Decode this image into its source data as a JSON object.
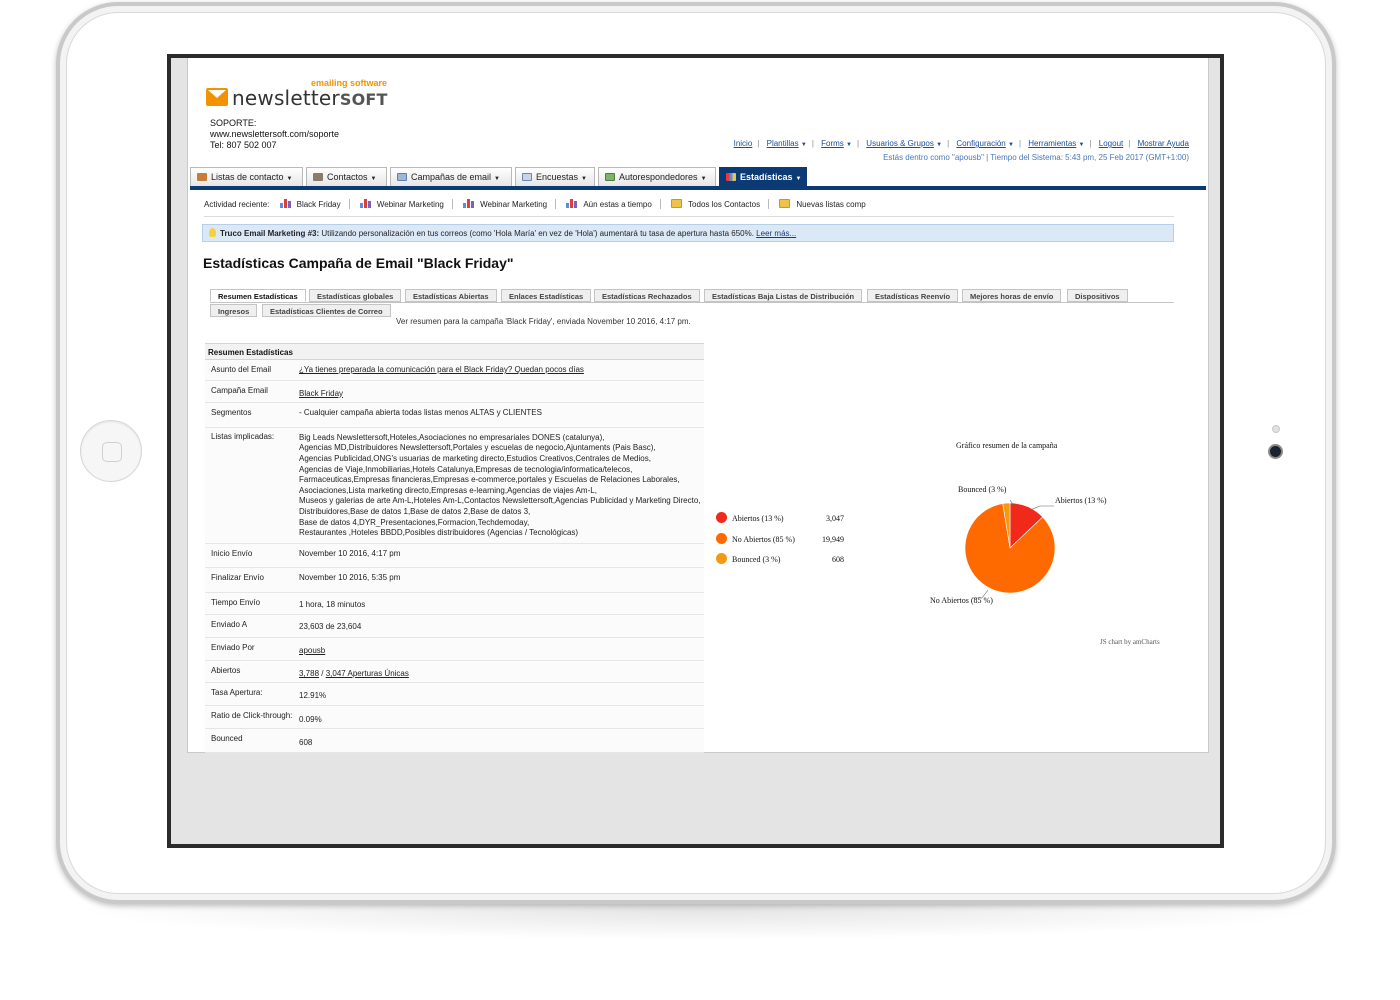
{
  "brand": {
    "name": "newsletter",
    "name_bold": "SOFT",
    "tagline": "emailing software"
  },
  "support": {
    "line1": "SOPORTE:",
    "line2": "www.newslettersoft.com/soporte",
    "line3": "Tel: 807 502 007"
  },
  "topnav": {
    "items": [
      "Inicio",
      "Plantillas",
      "Forms",
      "Usuarios & Grupos",
      "Configuración",
      "Herramientas",
      "Logout",
      "Mostrar Ayuda"
    ],
    "sysinfo": "Estás dentro como \"apousb\" | Tiempo del Sistema: 5:43 pm, 25 Feb 2017 (GMT+1:00)"
  },
  "tabs": [
    "Listas de contacto",
    "Contactos",
    "Campañas de email",
    "Encuestas",
    "Autorespondedores",
    "Estadísticas"
  ],
  "recent": {
    "label": "Actividad reciente:",
    "items": [
      "Black Friday",
      "Webinar Marketing",
      "Webinar Marketing",
      "Aún estas a tiempo",
      "Todos los Contactos",
      "Nuevas listas comp"
    ]
  },
  "tip": {
    "title": "Truco Email Marketing #3:",
    "text": " Utilizando personalización en tus correos (como 'Hola María' en vez de 'Hola') aumentará tu tasa de apertura hasta 650%.",
    "link": "Leer más..."
  },
  "page_title": "Estadísticas Campaña de Email \"Black Friday\"",
  "subtabs": [
    "Resumen Estadísticas",
    "Estadísticas globales",
    "Estadísticas Abiertas",
    "Enlaces Estadísticas",
    "Estadísticas Rechazados",
    "Estadísticas Baja Listas de Distribución",
    "Estadísticas Reenvío",
    "Mejores horas de envío",
    "Dispositivos",
    "Ingresos",
    "Estadísticas Clientes de Correo"
  ],
  "summary_line": "Ver resumen para la campaña 'Black Friday', enviada November 10 2016, 4:17 pm.",
  "stats": {
    "heading": "Resumen Estadísticas",
    "subject_label": "Asunto del Email",
    "subject": "¿Ya tienes preparada la comunicación para el Black Friday? Quedan pocos días",
    "campaign_label": "Campaña Email",
    "campaign": "Black Friday",
    "segments_label": "Segmentos",
    "segments": "- Cualquier campaña abierta todas listas menos ALTAS y CLIENTES",
    "lists_label": "Listas implicadas:",
    "lists": [
      "Big Leads Newslettersoft,Hoteles,Asociaciones no empresariales DONES (catalunya),",
      "Agencias MD,Distribuidores Newslettersoft,Portales y escuelas de negocio,Ajuntaments (Pais Basc),",
      "Agencias Publicidad,ONG's usuarias de marketing directo,Estudios Creativos,Centrales de Medios,",
      "Agencias de Viaje,Inmobiliarias,Hotels Catalunya,Empresas de tecnologia/informatica/telecos,",
      "Farmaceuticas,Empresas financieras,Empresas e-commerce,portales y Escuelas de Relaciones Laborales,",
      "Asociaciones,Lista marketing directo,Empresas e-learning,Agencias de viajes Am-L,",
      "Museos y galerias de arte Am-L,Hoteles Am-L,Contactos Newslettersoft,Agencias Publicidad y Marketing Directo,",
      "Distribuidores,Base de datos 1,Base de datos 2,Base de datos 3,",
      "Base de datos 4,DYR_Presentaciones,Formacion,Techdemoday,",
      "Restaurantes ,Hoteles BBDD,Posibles distribuidores (Agencias / Tecnológicas)"
    ],
    "start_label": "Inicio Envío",
    "start": "November 10 2016, 4:17 pm",
    "end_label": "Finalizar Envío",
    "end": "November 10 2016, 5:35 pm",
    "duration_label": "Tiempo Envío",
    "duration": "1 hora, 18 minutos",
    "sent_to_label": "Enviado A",
    "sent_to": "23,603 de 23,604",
    "sent_by_label": "Enviado Por",
    "sent_by": "apousb",
    "opens_label": "Abiertos",
    "opens_total": "3,788",
    "opens_sep": " / ",
    "opens_unique": "3,047 Aperturas Únicas",
    "open_rate_label": "Tasa Apertura:",
    "open_rate": "12.91%",
    "ctr_label": "Ratio de Click-through:",
    "ctr": "0.09%",
    "bounced_label": "Bounced",
    "bounced": "608"
  },
  "chart_data": {
    "type": "pie",
    "title": "Gráfico resumen de la campaña",
    "categories": [
      "Abiertos (13 %)",
      "No Abiertos (85 %)",
      "Bounced (3 %)"
    ],
    "values": [
      3047,
      19949,
      608
    ],
    "value_labels": [
      "3,047",
      "19,949",
      "608"
    ],
    "colors": [
      "#f0291a",
      "#ff6a00",
      "#f39a12"
    ],
    "legend_position": "left",
    "credit": "JS chart by amCharts"
  },
  "colors": {
    "nav_dark": "#0b3a75",
    "link": "#1a4d9c",
    "accent": "#f39200"
  }
}
